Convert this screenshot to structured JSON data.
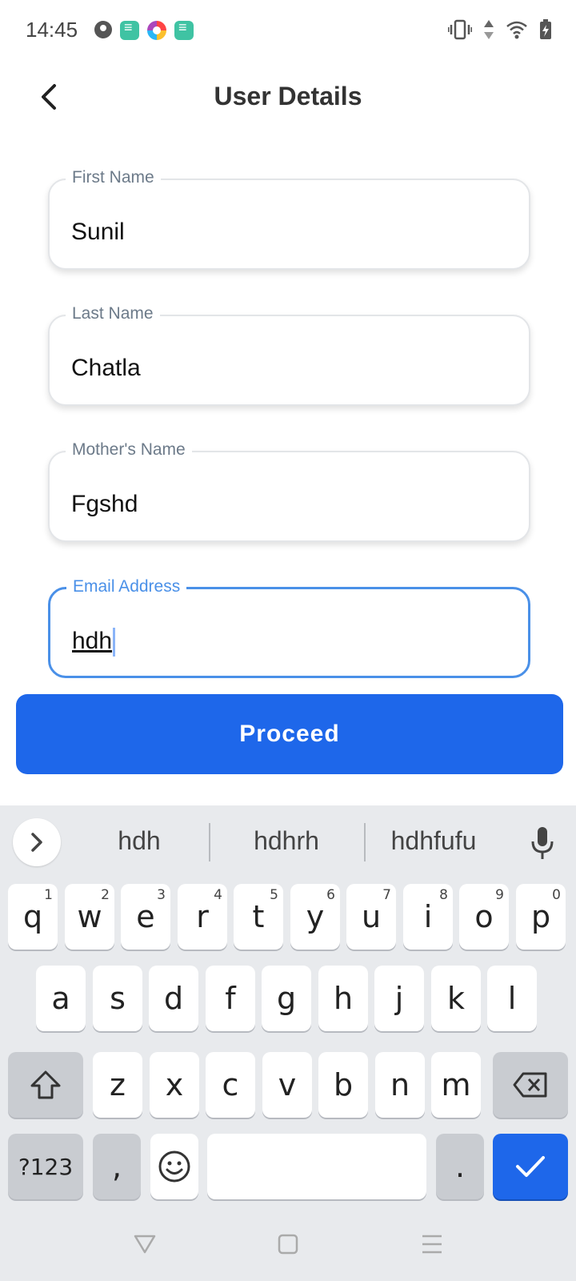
{
  "status_bar": {
    "time": "14:45",
    "notification_icons": [
      "pie-icon",
      "app-green-icon",
      "photos-icon",
      "app-green-icon"
    ]
  },
  "header": {
    "title": "User Details"
  },
  "form": {
    "fields": [
      {
        "label": "First Name",
        "value": "Sunil"
      },
      {
        "label": "Last Name",
        "value": "Chatla"
      },
      {
        "label": "Mother's Name",
        "value": "Fgshd"
      },
      {
        "label": "Email Address",
        "value": "hdh"
      }
    ],
    "focused_field": "Email Address"
  },
  "proceed": {
    "label": "Proceed",
    "color": "#1e67ea"
  },
  "keyboard": {
    "suggestions": [
      "hdh",
      "hdhrh",
      "hdhfufu"
    ],
    "row1": [
      {
        "k": "q",
        "h": "1"
      },
      {
        "k": "w",
        "h": "2"
      },
      {
        "k": "e",
        "h": "3"
      },
      {
        "k": "r",
        "h": "4"
      },
      {
        "k": "t",
        "h": "5"
      },
      {
        "k": "y",
        "h": "6"
      },
      {
        "k": "u",
        "h": "7"
      },
      {
        "k": "i",
        "h": "8"
      },
      {
        "k": "o",
        "h": "9"
      },
      {
        "k": "p",
        "h": "0"
      }
    ],
    "row2": [
      "a",
      "s",
      "d",
      "f",
      "g",
      "h",
      "j",
      "k",
      "l"
    ],
    "row3": [
      "z",
      "x",
      "c",
      "v",
      "b",
      "n",
      "m"
    ],
    "symbols_label": "?123",
    "comma_label": ",",
    "period_label": "."
  }
}
